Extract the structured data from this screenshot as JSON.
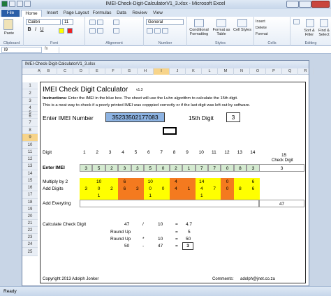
{
  "app": {
    "title": "IMEI-Check-Digit-CalculatorV1_3.xlsx  -  Microsoft Excel"
  },
  "tabs": [
    "File",
    "Home",
    "Insert",
    "Page Layout",
    "Formulas",
    "Data",
    "Review",
    "View"
  ],
  "ribbon": {
    "font_name": "Calibri",
    "font_size": "11",
    "paste": "Paste",
    "clipboard": "Clipboard",
    "font": "Font",
    "alignment": "Alignment",
    "number": "Number",
    "number_format": "General",
    "cond_format": "Conditional Formatting",
    "format_table": "Format as Table",
    "cell_styles": "Cell Styles",
    "styles": "Styles",
    "insert": "Insert",
    "delete": "Delete",
    "format": "Format",
    "cells": "Cells",
    "sort_filter": "Sort & Filter",
    "find_select": "Find & Select",
    "editing": "Editing"
  },
  "formula_bar": {
    "name_box": "I9",
    "fx": "fx",
    "content": ""
  },
  "document": {
    "title": "IMEI-Check-Digit-CalculatorV1_3.xlsx"
  },
  "columns": [
    "A",
    "B",
    "C",
    "D",
    "E",
    "F",
    "G",
    "H",
    "I",
    "J",
    "K",
    "L",
    "M",
    "N",
    "O",
    "P",
    "Q",
    "R"
  ],
  "rows": [
    "1",
    "2",
    "3",
    "4",
    "5",
    "6",
    "7",
    "8",
    "9",
    "10",
    "11",
    "12",
    "13",
    "14",
    "15",
    "16",
    "17",
    "18",
    "19",
    "20",
    "21",
    "22",
    "23",
    "24",
    "25"
  ],
  "sheet": {
    "heading": "IMEI Check Digit Calculator",
    "version": "v1.3",
    "instr1": "Instructions: Enter the IMEI in the blue box. The sheet will use the Luhn algorithm to calculate the 15th digit.",
    "instr1_bold": "Instructions:",
    "instr2": "This is a neat way to check if a poorly printed IMEI was copppied correctly or if the last digit was left out by software.",
    "enter_label": "Enter IMEI Number",
    "imei": "35233502177083",
    "digit15_label": "15th Digit",
    "digit15": "3",
    "digit_label": "Digit",
    "digit_numbers": [
      "1",
      "2",
      "3",
      "4",
      "5",
      "6",
      "7",
      "8",
      "9",
      "10",
      "11",
      "12",
      "13",
      "14"
    ],
    "check_digit_label": "15",
    "check_digit_title": "Check Digit",
    "enter_imei_label": "Enter IMEI",
    "imei_digits": [
      "3",
      "5",
      "2",
      "3",
      "3",
      "5",
      "0",
      "2",
      "1",
      "7",
      "7",
      "0",
      "8",
      "3",
      "3"
    ],
    "multiply_label": "Multiply by 2",
    "multiply_values": [
      "",
      "10",
      "",
      "6",
      "",
      "10",
      "",
      "4",
      "",
      "14",
      "",
      "0",
      "",
      "6"
    ],
    "add_digits_label": "Add Digits",
    "add_digits_values": [
      "3",
      "0",
      "2",
      "6",
      "3",
      "0",
      "0",
      "4",
      "1",
      "4",
      "7",
      "0",
      "8",
      "6"
    ],
    "add_digits_row2": [
      "",
      "1",
      "",
      "",
      "",
      "1",
      "",
      "",
      "",
      "1",
      "",
      "",
      "",
      ""
    ],
    "add_every_label": "Add Everyting",
    "total": "47",
    "calc_label": "Calculate Check Digit",
    "calc_a": "47",
    "calc_op1": "/",
    "calc_b": "10",
    "calc_eq1": "=",
    "calc_r1": "4.7",
    "roundup1_label": "Round Up",
    "calc_eq2": "=",
    "calc_r2": "5",
    "roundup2_label": "Round Up",
    "calc_op2": "*",
    "calc_b2": "10",
    "calc_eq3": "=",
    "calc_r3": "50",
    "calc_c": "50",
    "calc_op3": "-",
    "calc_d": "47",
    "calc_eq4": "=",
    "calc_result": "3",
    "copyright": "Copyright 2013 Adolph Jonker",
    "comments_label": "Comments:",
    "email": "adolph@jnet.co.za"
  },
  "status": {
    "ready": "Ready"
  }
}
